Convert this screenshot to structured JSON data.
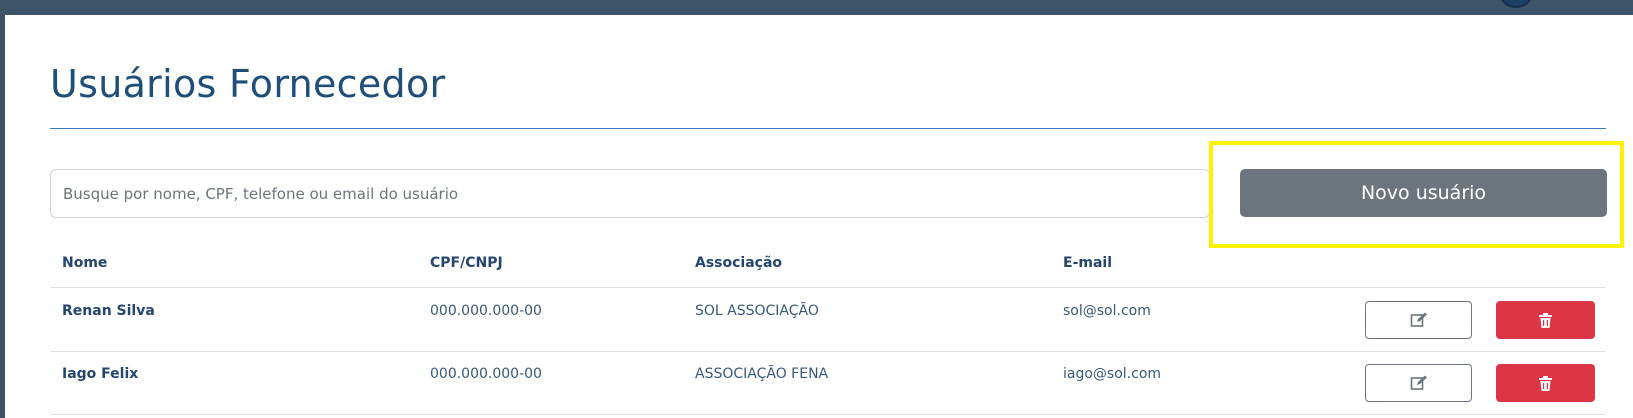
{
  "page": {
    "title": "Usuários Fornecedor"
  },
  "search": {
    "placeholder": "Busque por nome, CPF, telefone ou email do usuário",
    "value": ""
  },
  "actions": {
    "new_user_label": "Novo usuário"
  },
  "table": {
    "headers": [
      "Nome",
      "CPF/CNPJ",
      "Associação",
      "E-mail"
    ],
    "rows": [
      {
        "name": "Renan Silva",
        "document": "000.000.000-00",
        "association": "SOL ASSOCIAÇÃO",
        "email": "sol@sol.com"
      },
      {
        "name": "Iago Felix",
        "document": "000.000.000-00",
        "association": "ASSOCIAÇÃO FENA",
        "email": "iago@sol.com"
      }
    ],
    "row_actions": {
      "edit_icon": "edit-icon",
      "delete_icon": "trash-icon"
    }
  },
  "colors": {
    "title": "#1f4e79",
    "primary_button": "#6c757d",
    "danger_button": "#dc3545",
    "highlight": "#fff200"
  }
}
